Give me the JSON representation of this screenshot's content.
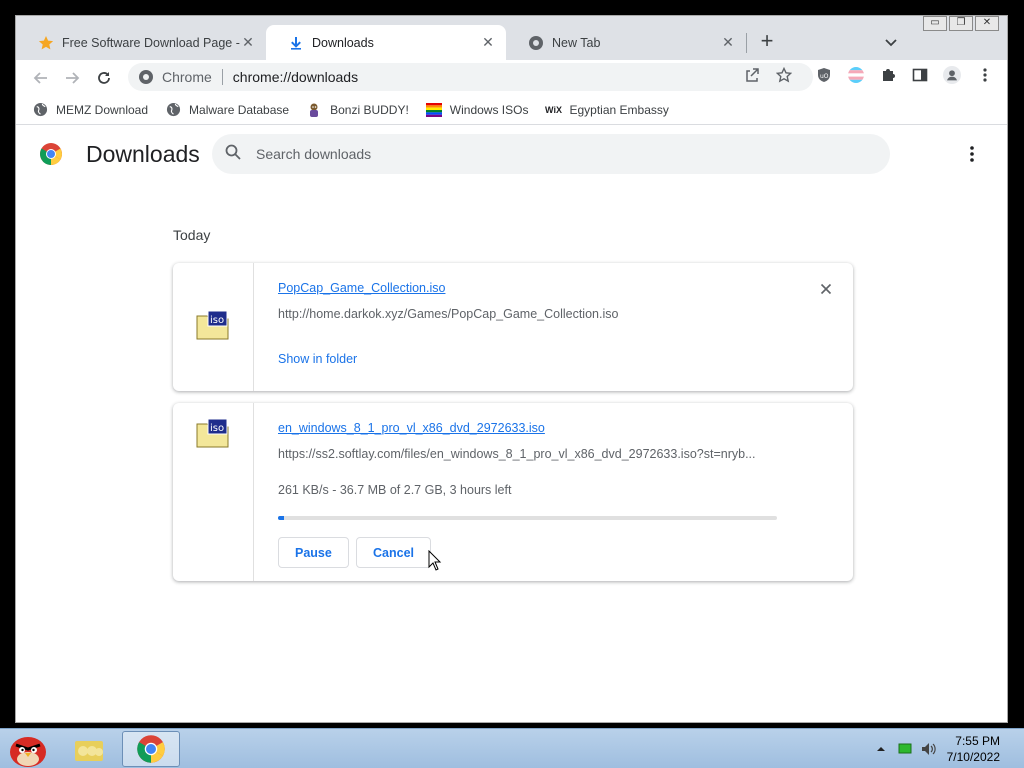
{
  "tabs": [
    {
      "title": "Free Software Download Page - S",
      "icon": "star-icon",
      "active": false
    },
    {
      "title": "Downloads",
      "icon": "download-icon",
      "active": true
    },
    {
      "title": "New Tab",
      "icon": "chrome-globe-icon",
      "active": false
    }
  ],
  "omnibox": {
    "chip": "Chrome",
    "url": "chrome://downloads"
  },
  "bookmarks": [
    {
      "label": "MEMZ Download",
      "icon": "globe-icon"
    },
    {
      "label": "Malware Database",
      "icon": "globe-icon"
    },
    {
      "label": "Bonzi BUDDY!",
      "icon": "bonzi-icon"
    },
    {
      "label": "Windows ISOs",
      "icon": "rainbow-flag-icon"
    },
    {
      "label": "Egyptian Embassy",
      "icon": "wix-icon",
      "icon_text": "WiX"
    }
  ],
  "downloads_page": {
    "title": "Downloads",
    "search_placeholder": "Search downloads",
    "date_heading": "Today",
    "items": [
      {
        "filename": "PopCap_Game_Collection.iso",
        "url": "http://home.darkok.xyz/Games/PopCap_Game_Collection.iso",
        "action_label": "Show in folder",
        "icon": "iso-file-icon",
        "icon_text": "iso",
        "state": "complete"
      },
      {
        "filename": "en_windows_8_1_pro_vl_x86_dvd_2972633.iso",
        "url": "https://ss2.softlay.com/files/en_windows_8_1_pro_vl_x86_dvd_2972633.iso?st=nryb...",
        "status": "261 KB/s - 36.7 MB of 2.7 GB, 3 hours left",
        "progress_percent": 1.3,
        "pause_label": "Pause",
        "cancel_label": "Cancel",
        "icon": "iso-file-icon",
        "icon_text": "iso",
        "state": "in_progress"
      }
    ]
  },
  "taskbar": {
    "apps": [
      "angry-birds-icon",
      "folder-icon",
      "chrome-icon"
    ],
    "time": "7:55 PM",
    "date": "7/10/2022"
  },
  "colors": {
    "accent": "#1a73e8",
    "tabstrip": "#dee1e6"
  }
}
